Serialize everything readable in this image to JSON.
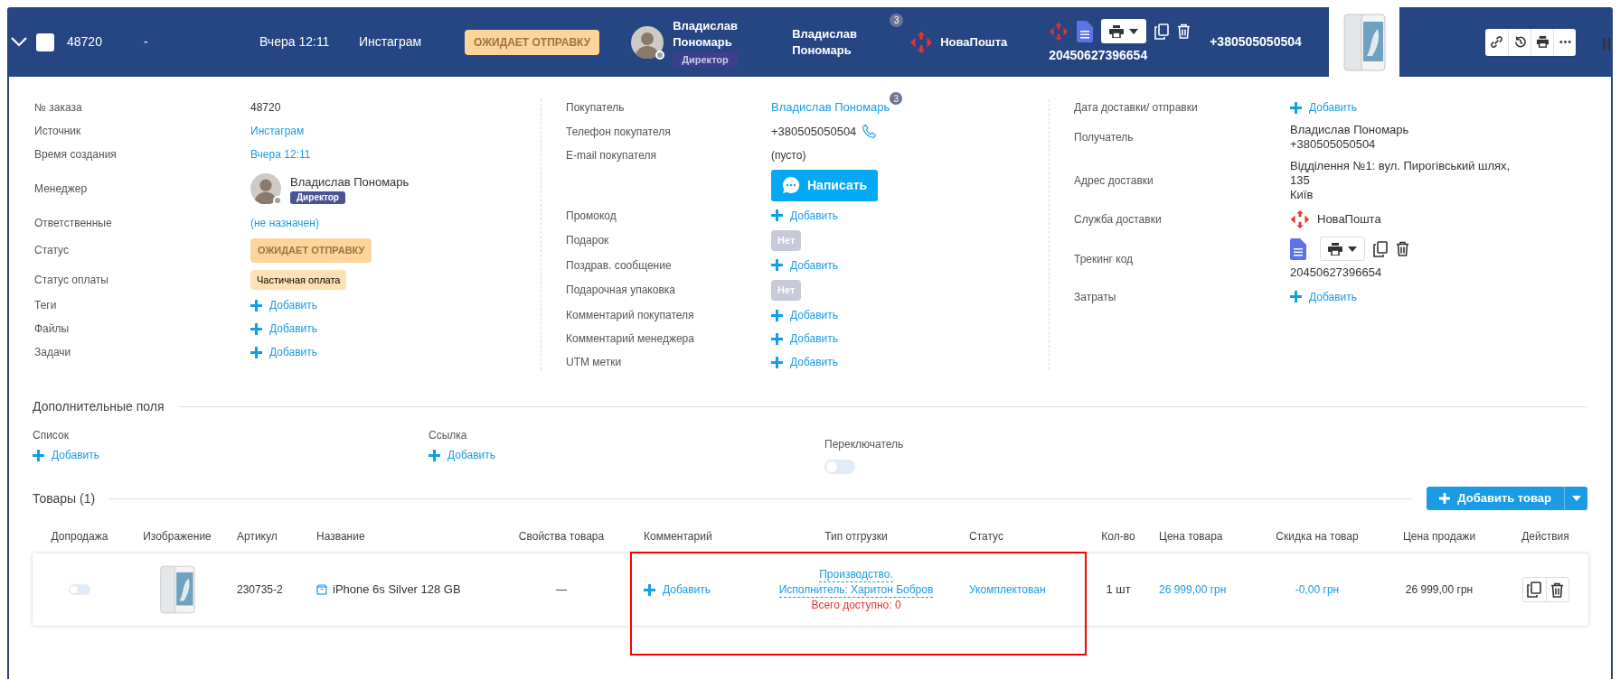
{
  "header": {
    "expanded": true,
    "checked": false,
    "order_number": "48720",
    "dash": "-",
    "created": "Вчера 12:11",
    "source": "Инстаграм",
    "status": "ОЖИДАЕТ ОТПРАВКУ",
    "manager": "Владислав Пономарь",
    "manager_role": "Директор",
    "buyer": "Владислав Пономарь",
    "buyer_orders": "3",
    "delivery_service": "НоваПошта",
    "tracking": "20450627396654",
    "phone": "+380505050504"
  },
  "details": [
    [
      {
        "label": "№ заказа",
        "kind": "text",
        "value": "48720"
      },
      {
        "label": "Источник",
        "kind": "link",
        "value": "Инстаграм"
      },
      {
        "label": "Время создания",
        "kind": "link",
        "value": "Вчера 12:11"
      },
      {
        "label": "Менеджер",
        "kind": "manager",
        "value": "Владислав Пономарь",
        "role": "Директор"
      },
      {
        "label": "Ответственные",
        "kind": "link",
        "value": "(не назначен)"
      },
      {
        "label": "Статус",
        "kind": "status",
        "value": "ОЖИДАЕТ ОТПРАВКУ"
      },
      {
        "label": "Статус оплаты",
        "kind": "payment",
        "value": "Частичная оплата"
      },
      {
        "label": "Теги",
        "kind": "add",
        "value": "Добавить"
      },
      {
        "label": "Файлы",
        "kind": "add",
        "value": "Добавить"
      },
      {
        "label": "Задачи",
        "kind": "add",
        "value": "Добавить"
      }
    ],
    [
      {
        "label": "Покупатель",
        "kind": "buyer",
        "value": "Владислав Пономарь",
        "count": "3"
      },
      {
        "label": "Телефон покупателя",
        "kind": "phone",
        "value": "+380505050504"
      },
      {
        "label": "E-mail покупателя",
        "kind": "text",
        "value": "(пусто)"
      },
      {
        "kind": "button",
        "value": "Написать"
      },
      {
        "label": "Промокод",
        "kind": "add",
        "value": "Добавить"
      },
      {
        "label": "Подарок",
        "kind": "no",
        "value": "Нет"
      },
      {
        "label": "Поздрав. сообщение",
        "kind": "add",
        "value": "Добавить"
      },
      {
        "label": "Подарочная упаковка",
        "kind": "no",
        "value": "Нет"
      },
      {
        "label": "Комментарий покупателя",
        "kind": "add",
        "value": "Добавить"
      },
      {
        "label": "Комментарий менеджера",
        "kind": "add",
        "value": "Добавить"
      },
      {
        "label": "UTM метки",
        "kind": "add",
        "value": "Добавить"
      }
    ],
    [
      {
        "label": "Дата доставки/ отправки",
        "kind": "add",
        "value": "Добавить"
      },
      {
        "label": "Получатель",
        "kind": "lines",
        "lines": [
          "Владислав Пономарь",
          "+380505050504"
        ]
      },
      {
        "label": "Адрес доставки",
        "kind": "lines",
        "lines": [
          "Відділення №1: вул. Пирогівський шлях, 135",
          "Київ"
        ]
      },
      {
        "label": "Служба доставки",
        "kind": "service",
        "value": "НоваПошта"
      },
      {
        "label": "Трекинг код",
        "kind": "tracking",
        "value": "20450627396654"
      },
      {
        "label": "Затраты",
        "kind": "add",
        "value": "Добавить"
      }
    ]
  ],
  "extra_fields": {
    "title": "Дополнительные поля",
    "fields": [
      {
        "label": "Список",
        "kind": "add",
        "value": "Добавить"
      },
      {
        "label": "Ссылка",
        "kind": "add",
        "value": "Добавить"
      },
      {
        "label": "Переключатель",
        "kind": "toggle",
        "on": false
      }
    ]
  },
  "products": {
    "title": "Товары (1)",
    "add_button": "Добавить товар",
    "columns": [
      "Допродажа",
      "Изображение",
      "Артикул",
      "Название",
      "Свойства товара",
      "Комментарий",
      "Тип отгрузки",
      "Статус",
      "Кол-во",
      "Цена товара",
      "Скидка на товар",
      "Цена продажи",
      "Действия"
    ],
    "rows": [
      {
        "upsell_on": false,
        "article": "230735-2",
        "name": "iPhone 6s Silver 128 GB",
        "properties": "—",
        "comment": "Добавить",
        "shipment": [
          "Производство.",
          "Исполнитель: Харитон Бобров"
        ],
        "availability": "Всего доступно: 0",
        "status": "Укомплектован",
        "qty": "1 шт",
        "price": "26 999,00 грн",
        "discount": "-0,00 грн",
        "sale_price": "26 999,00 грн"
      }
    ]
  }
}
